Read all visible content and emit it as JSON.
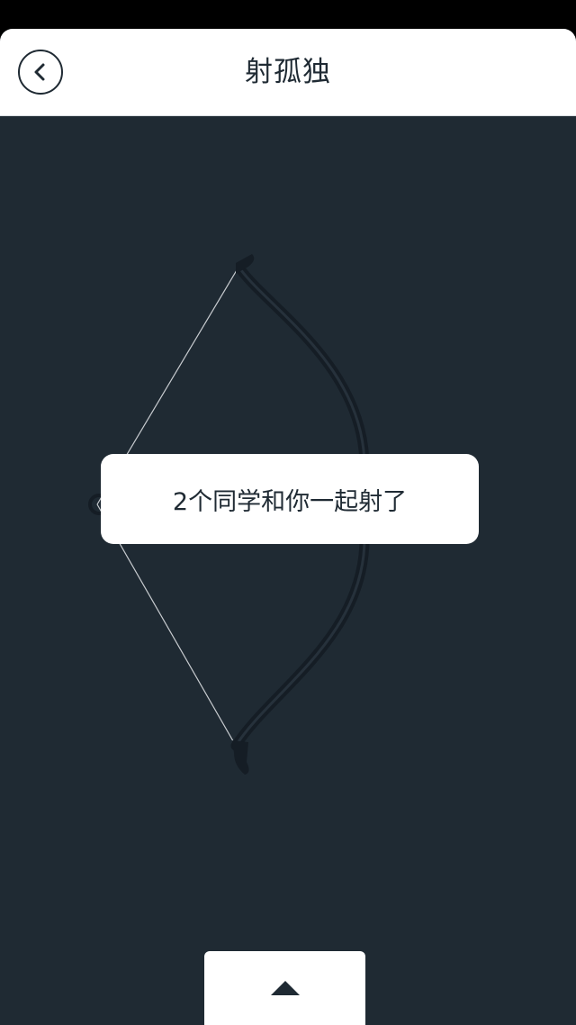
{
  "header": {
    "title": "射孤独",
    "back_icon": "chevron-left-icon"
  },
  "toast": {
    "message": "2个同学和你一起射了"
  },
  "footer": {
    "expand_icon": "triangle-up-icon"
  },
  "colors": {
    "background": "#1f2a33",
    "header": "#ffffff",
    "text": "#1f2a33",
    "bow": "#151d25",
    "bowstring": "#c8ccd0"
  }
}
